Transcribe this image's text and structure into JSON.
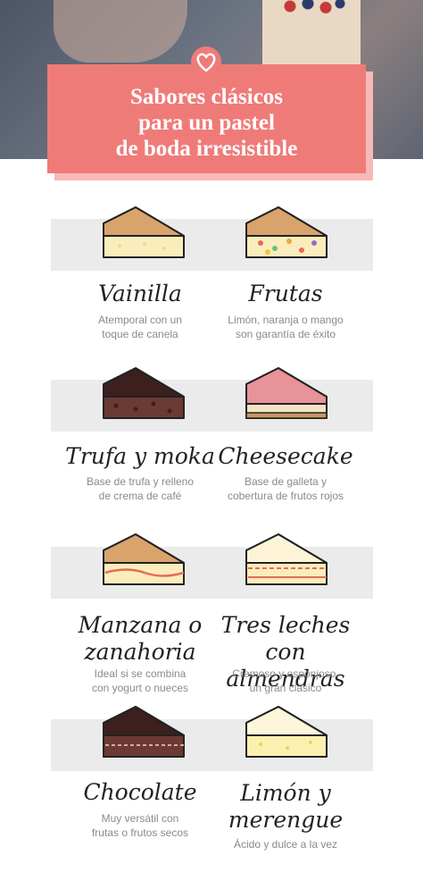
{
  "title": "Sabores clásicos para un pastel de boda irresistible",
  "title_lines": [
    "Sabores clásicos",
    "para un pastel",
    "de boda irresistible"
  ],
  "colors": {
    "accent": "#ef7b78",
    "accent_shadow": "#f7b9b7",
    "band": "#ebebeb"
  },
  "icon": "heart-icon",
  "flavors": [
    {
      "name": "Vainilla",
      "desc": [
        "Atemporal con un",
        "toque de canela"
      ]
    },
    {
      "name": "Frutas",
      "desc": [
        "Limón, naranja o mango",
        "son garantía de éxito"
      ]
    },
    {
      "name": "Trufa y moka",
      "desc": [
        "Base de trufa y relleno",
        "de crema de café"
      ]
    },
    {
      "name": "Cheesecake",
      "desc": [
        "Base de galleta y",
        "cobertura de frutos rojos"
      ]
    },
    {
      "name": [
        "Manzana o",
        "zanahoria"
      ],
      "desc": [
        "Ideal si se combina",
        "con yogurt o nueces"
      ]
    },
    {
      "name": [
        "Tres leches",
        "con almendras"
      ],
      "desc": [
        "Cremoso y esponjoso,",
        "un gran clásico"
      ]
    },
    {
      "name": "Chocolate",
      "desc": [
        "Muy versátil con",
        "frutas o frutos secos"
      ]
    },
    {
      "name": [
        "Limón y",
        "merengue"
      ],
      "desc": [
        "Ácido y dulce a la vez"
      ]
    }
  ]
}
